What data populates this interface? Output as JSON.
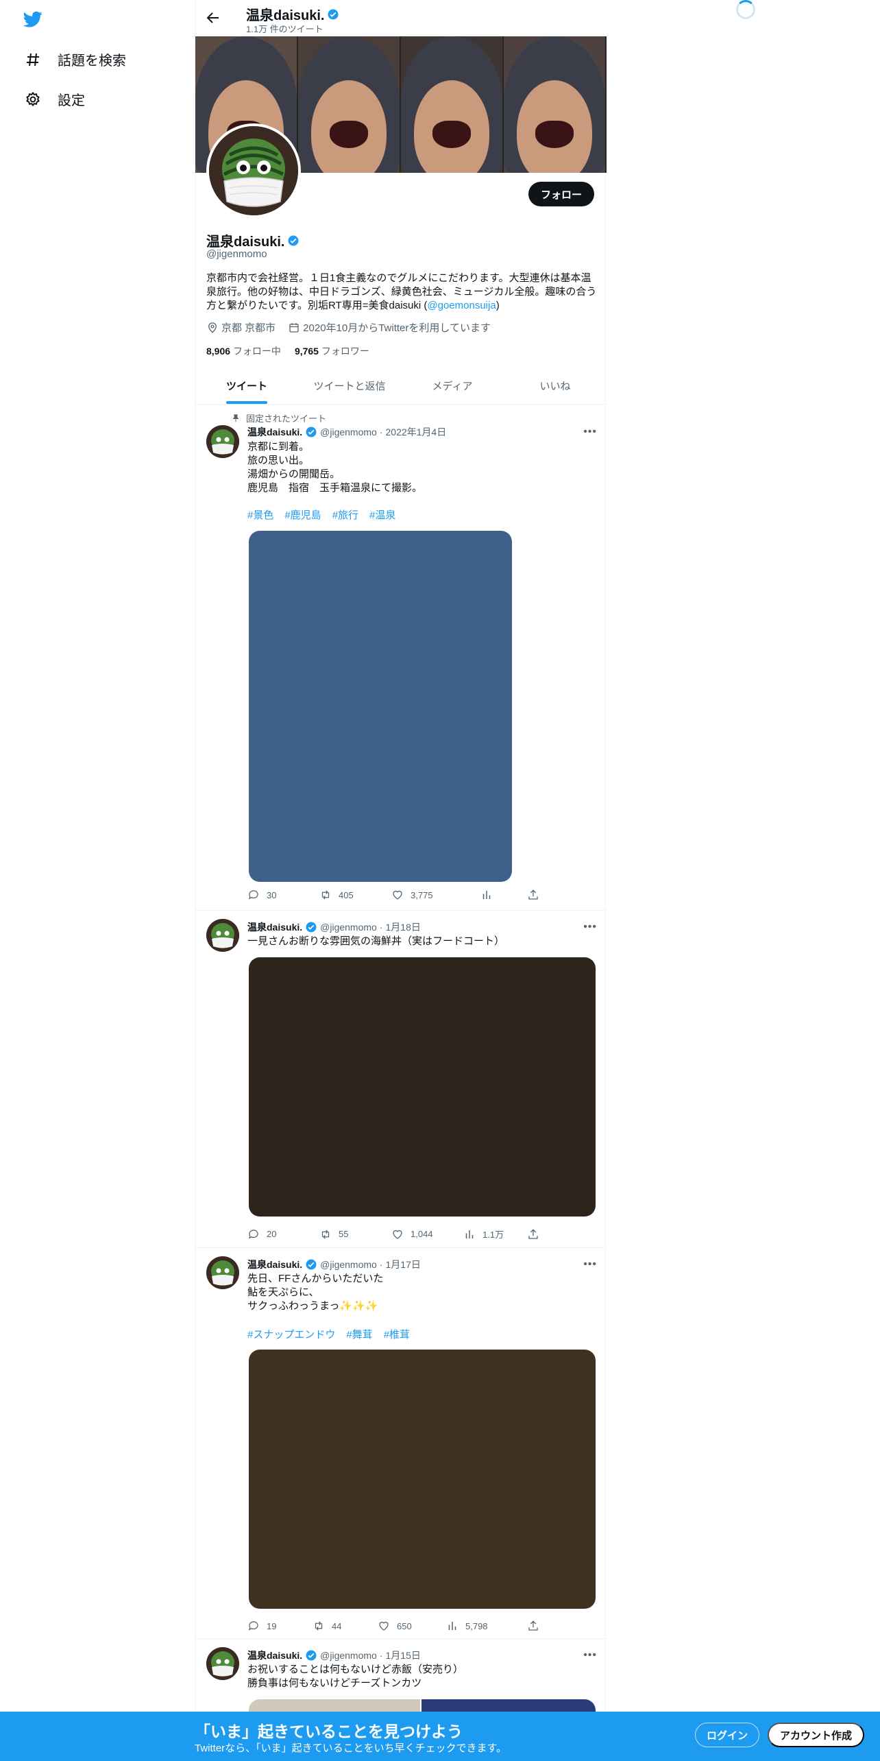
{
  "sidebar": {
    "items": [
      {
        "label": "話題を検索",
        "icon": "hashtag-icon"
      },
      {
        "label": "設定",
        "icon": "gear-icon"
      }
    ]
  },
  "header": {
    "name": "温泉daisuki.",
    "tweet_count": "1.1万 件のツイート"
  },
  "profile": {
    "name": "温泉daisuki.",
    "handle": "@jigenmomo",
    "follow_label": "フォロー",
    "bio_text": "京都市内で会社経営。１日1食主義なのでグルメにこだわります。大型連休は基本温泉旅行。他の好物は、中日ドラゴンズ、緑黄色社会、ミュージカル全般。趣味の合う方と繋がりたいです。別垢RT専用=美食daisuki (",
    "bio_link": "@goemonsuija",
    "bio_end": ")",
    "location": "京都 京都市",
    "joined": "2020年10月からTwitterを利用しています",
    "following_count": "8,906",
    "following_label": "フォロー中",
    "followers_count": "9,765",
    "followers_label": "フォロワー"
  },
  "tabs": [
    "ツイート",
    "ツイートと返信",
    "メディア",
    "いいね"
  ],
  "pinned_label": "固定されたツイート",
  "tweets": [
    {
      "name": "温泉daisuki.",
      "handle": "@jigenmomo",
      "date": "2022年1月4日",
      "lines": [
        "京都に到着。",
        "旅の思い出。",
        "湯畑からの開聞岳。",
        "鹿児島　指宿　玉手箱温泉にて撮影。"
      ],
      "tags": [
        "#景色",
        "#鹿児島",
        "#旅行",
        "#温泉"
      ],
      "media_color": "#40608c",
      "replies": "30",
      "retweets": "405",
      "likes": "3,775",
      "views": ""
    },
    {
      "name": "温泉daisuki.",
      "handle": "@jigenmomo",
      "date": "1月18日",
      "lines": [
        "一見さんお断りな雰囲気の海鮮丼（実はフードコート）"
      ],
      "tags": [],
      "media_color": "#2d241b",
      "replies": "20",
      "retweets": "55",
      "likes": "1,044",
      "views": "1.1万"
    },
    {
      "name": "温泉daisuki.",
      "handle": "@jigenmomo",
      "date": "1月17日",
      "lines": [
        "先日、FFさんからいただいた",
        "鮎を天ぷらに、",
        "サクっふわっうまっ✨✨✨"
      ],
      "tags": [
        "#スナップエンドウ",
        "#舞茸",
        "#椎茸"
      ],
      "media_color": "#40301f",
      "replies": "19",
      "retweets": "44",
      "likes": "650",
      "views": "5,798"
    },
    {
      "name": "温泉daisuki.",
      "handle": "@jigenmomo",
      "date": "1月15日",
      "lines": [
        "お祝いすることは何もないけど赤飯（安売り）",
        "勝負事は何もないけどチーズトンカツ"
      ],
      "tags": [],
      "media_color": "#d0c8b8",
      "replies": "",
      "retweets": "",
      "likes": "",
      "views": ""
    }
  ],
  "bottom_bar": {
    "title": "「いま」起きていることを見つけよう",
    "subtitle": "Twitterなら、「いま」起きていることをいち早くチェックできます。",
    "login": "ログイン",
    "signup": "アカウント作成"
  },
  "colors": {
    "accent": "#1d9bf0",
    "text": "#0f1419",
    "muted": "#536471"
  }
}
